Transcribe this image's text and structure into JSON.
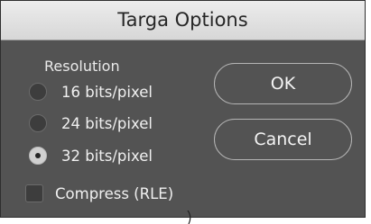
{
  "dialog": {
    "title": "Targa Options",
    "resolution": {
      "legend": "Resolution",
      "options": [
        {
          "label": "16 bits/pixel",
          "checked": false
        },
        {
          "label": "24 bits/pixel",
          "checked": false
        },
        {
          "label": "32 bits/pixel",
          "checked": true
        }
      ]
    },
    "compress": {
      "label": "Compress (RLE)",
      "checked": false
    },
    "buttons": {
      "ok": "OK",
      "cancel": "Cancel"
    }
  },
  "colors": {
    "dialog_bg": "#535353",
    "titlebar_bg": "#e2e2e2",
    "text": "#f0f0f0"
  }
}
